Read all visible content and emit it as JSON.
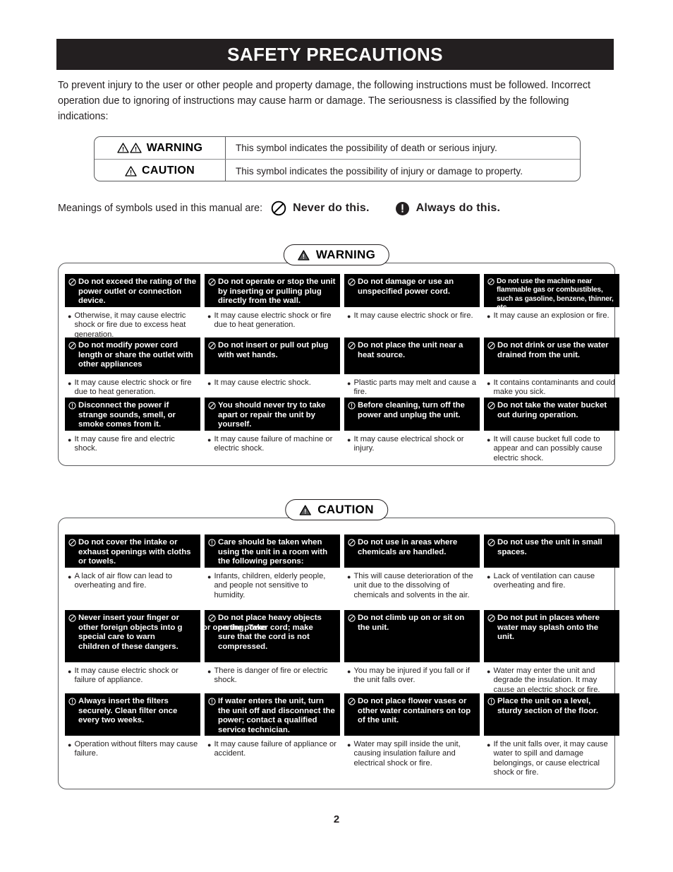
{
  "header": {
    "title": "SAFETY PRECAUTIONS"
  },
  "intro": "To prevent injury to the user or other people and property damage, the following instructions must be followed. Incorrect operation due to ignoring of instructions may cause harm or damage. The seriousness is classified by the following indications:",
  "definitions": {
    "warning": {
      "label": "WARNING",
      "description": "This symbol indicates the possibility of death or serious injury."
    },
    "caution": {
      "label": "CAUTION",
      "description": "This symbol indicates the possibility of injury or damage to property."
    }
  },
  "symbols": {
    "lead": "Meanings of symbols used in this manual are:",
    "never": "Never do this.",
    "always": "Always do this."
  },
  "warning_section": {
    "badge": "WARNING",
    "items": [
      {
        "icon": "prohibition-icon",
        "head": "Do not exceed the rating of the power outlet or connection device.",
        "body": "Otherwise, it may cause electric shock or fire due to excess heat generation."
      },
      {
        "icon": "prohibition-icon",
        "head": "Do not operate or stop the unit by inserting or pulling plug directly from the wall.",
        "body": "It may cause electric shock or fire due to heat generation."
      },
      {
        "icon": "prohibition-icon",
        "head": "Do not damage or use an unspecified power cord.",
        "body": "It may cause electric shock or fire."
      },
      {
        "icon": "prohibition-icon",
        "head": "Do not use the machine near flammable gas or combustibles, such as gasoline, benzene, thinner, etc.",
        "body": "It may cause an explosion or fire."
      },
      {
        "icon": "prohibition-icon",
        "head": "Do not modify power cord length or share the outlet with other appliances",
        "body": "It may cause electric shock or fire due to heat generation."
      },
      {
        "icon": "prohibition-icon",
        "head": "Do not insert or pull out plug with wet hands.",
        "body": "It may cause electric shock."
      },
      {
        "icon": "prohibition-icon",
        "head": "Do not place the unit near a heat source.",
        "body": "Plastic parts may melt and cause a fire."
      },
      {
        "icon": "prohibition-icon",
        "head": "Do not drink or use the water drained from the unit.",
        "body": "It contains contaminants and could make you sick."
      },
      {
        "icon": "mandatory-icon",
        "head": "Disconnect the power if strange sounds, smell, or smoke comes from it.",
        "body": "It may cause fire and electric shock."
      },
      {
        "icon": "prohibition-icon",
        "head": "You should never try to take apart or repair the unit by yourself.",
        "body": "It may cause failure of machine or electric shock."
      },
      {
        "icon": "mandatory-icon",
        "head": "Before cleaning, turn off the power and unplug the unit.",
        "body": "It may cause electrical shock or injury."
      },
      {
        "icon": "prohibition-icon",
        "head": "Do not take the water bucket out during operation.",
        "body": "It will cause bucket full code to appear and can possibly cause electric shock."
      }
    ]
  },
  "caution_section": {
    "badge": "CAUTION",
    "items": [
      {
        "icon": "prohibition-icon",
        "head": "Do not cover the intake or exhaust openings with cloths or towels.",
        "body": "A lack of air flow can lead to overheating and fire."
      },
      {
        "icon": "mandatory-icon",
        "head": "Care should be taken when using the unit in a room with the following persons:",
        "body": "Infants, children, elderly people, and people not sensitive to humidity."
      },
      {
        "icon": "prohibition-icon",
        "head": "Do not use in areas where chemicals are handled.",
        "body": "This will cause deterioration of the unit due to the dissolving of chemicals and solvents in the air."
      },
      {
        "icon": "prohibition-icon",
        "head": "Do not use the unit in small spaces.",
        "body": "Lack of ventilation can cause overheating and fire."
      },
      {
        "icon": "prohibition-icon",
        "head_lines": [
          "Never insert your finger or",
          "other foreign objects into g",
          "special care to warn",
          "children of these dangers."
        ],
        "body": "It may cause electric shock or failure of appliance."
      },
      {
        "icon": "prohibition-icon",
        "head_lines": [
          "Do not place heavy objects",
          "on the power cord; make",
          "sure that the cord is not",
          "compressed."
        ],
        "head_overlay": "or opening. Take",
        "body": "There is danger of fire or electric shock."
      },
      {
        "icon": "prohibition-icon",
        "head": "Do not climb up on or sit on the unit.",
        "body": "You may be injured if you fall or if the unit falls over."
      },
      {
        "icon": "prohibition-icon",
        "head": "Do not put in places where water may splash onto the unit.",
        "body": "Water may enter the unit and degrade the insulation. It may cause an electric shock or fire."
      },
      {
        "icon": "mandatory-icon",
        "head": "Always insert the filters securely. Clean filter once every two weeks.",
        "body": "Operation without filters may cause failure."
      },
      {
        "icon": "mandatory-icon",
        "head": "If water enters the unit, turn the unit off and disconnect the power; contact a qualified service technician.",
        "body": "It may cause failure of appliance or accident."
      },
      {
        "icon": "prohibition-icon",
        "head": "Do not place flower vases or other water containers on top of the unit.",
        "body": "Water may spill inside the unit, causing insulation failure and electrical shock or fire."
      },
      {
        "icon": "mandatory-icon",
        "head": "Place the unit on a level, sturdy section of the floor.",
        "body": "If the unit falls over, it may cause water to spill and damage belongings, or cause electrical shock or fire."
      }
    ]
  },
  "footer": {
    "page_number": "2"
  },
  "colors": {
    "header_bg": "#231f20",
    "item_head_bg": "#000000",
    "border": "#58595b",
    "text": "#231f20"
  }
}
